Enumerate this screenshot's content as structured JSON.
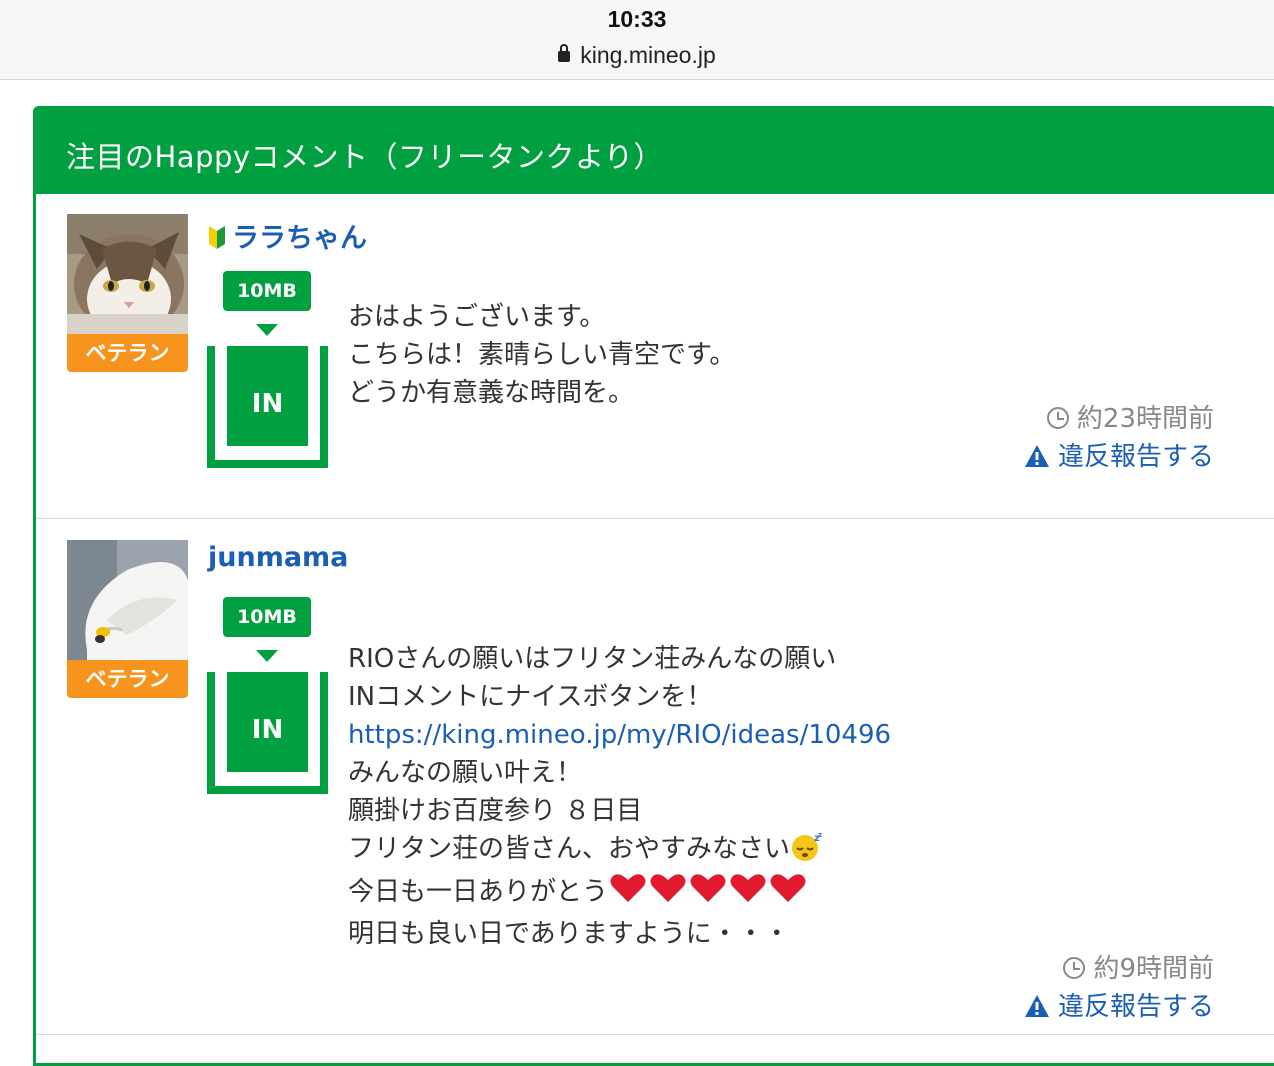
{
  "status": {
    "time": "10:33",
    "url": "king.mineo.jp"
  },
  "panel": {
    "title": "注目のHappyコメント（フリータンクより）"
  },
  "comments": [
    {
      "user": "ララちゃん",
      "badge": "ベテラン",
      "amount": "10MB",
      "direction": "IN",
      "lines": [
        "おはようございます。",
        "こちらは！素晴らしい青空です。",
        "どうか有意義な時間を。"
      ],
      "time_ago": "約23時間前",
      "report": "違反報告する"
    },
    {
      "user": "junmama",
      "badge": "ベテラン",
      "amount": "10MB",
      "direction": "IN",
      "lines": [
        "RIOさんの願いはフリタン荘みんなの願い",
        "INコメントにナイスボタンを！",
        "https://king.mineo.jp/my/RIO/ideas/10496",
        "みんなの願い叶え！",
        "願掛けお百度参り ８日目",
        "フリタン荘の皆さん、おやすみなさい",
        "今日も一日ありがとう",
        "明日も良い日でありますように・・・"
      ],
      "time_ago": "約9時間前",
      "report": "違反報告する"
    }
  ]
}
